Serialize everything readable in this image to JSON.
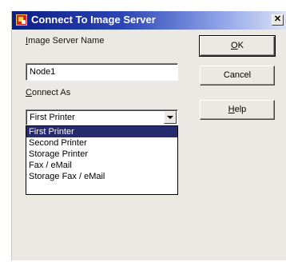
{
  "window": {
    "title": "Connect To Image Server",
    "close_label": "✕"
  },
  "form": {
    "server_name_label": "Image Server Name",
    "server_name_value": "Node1",
    "connect_as_label": "Connect As",
    "connect_as_value": "First Printer",
    "connect_as_options": [
      "First Printer",
      "Second Printer",
      "Storage Printer",
      "Fax / eMail",
      "Storage Fax / eMail"
    ],
    "connect_as_selected_index": 0
  },
  "buttons": {
    "ok_label": "OK",
    "cancel_label": "Cancel",
    "help_label": "Help"
  },
  "colors": {
    "title_gradient_start": "#0a1f86",
    "dialog_background": "#ece9e4",
    "selection_background": "#262a6e"
  }
}
